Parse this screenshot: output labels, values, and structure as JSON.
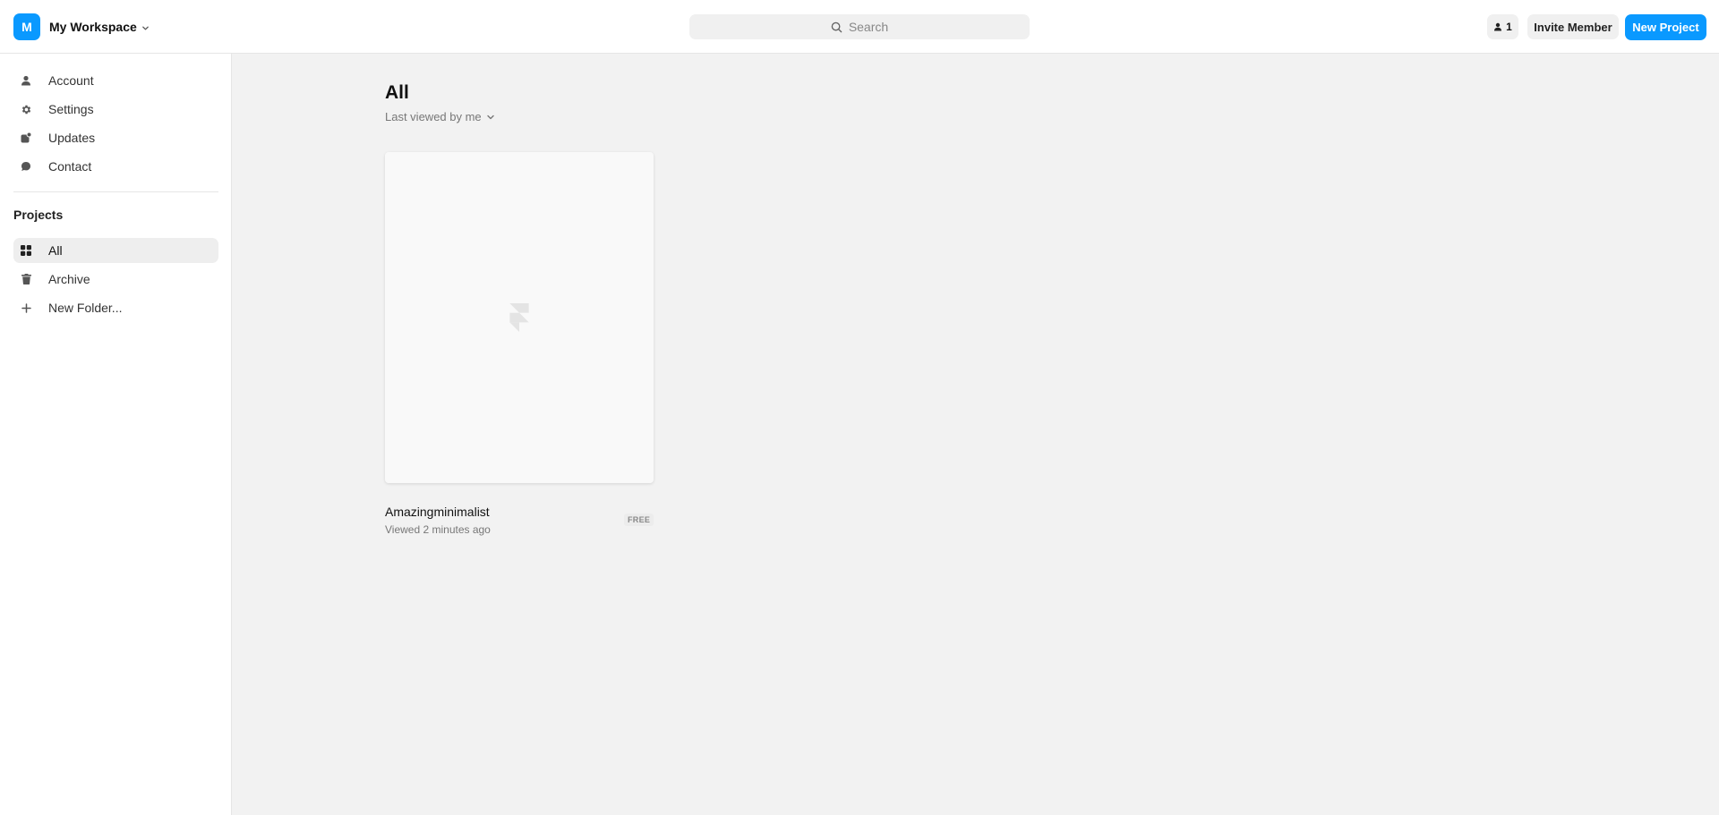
{
  "header": {
    "workspace_initial": "M",
    "workspace_name": "My Workspace",
    "search_placeholder": "Search",
    "member_count": "1",
    "invite_label": "Invite Member",
    "new_project_label": "New Project"
  },
  "sidebar": {
    "nav": [
      {
        "label": "Account",
        "icon": "user-icon"
      },
      {
        "label": "Settings",
        "icon": "gear-icon"
      },
      {
        "label": "Updates",
        "icon": "updates-icon"
      },
      {
        "label": "Contact",
        "icon": "chat-bubble-icon"
      }
    ],
    "projects_title": "Projects",
    "projects": [
      {
        "label": "All",
        "icon": "grid-icon",
        "active": true
      },
      {
        "label": "Archive",
        "icon": "trash-icon",
        "active": false
      },
      {
        "label": "New Folder...",
        "icon": "plus-icon",
        "active": false
      }
    ]
  },
  "main": {
    "title": "All",
    "sort_label": "Last viewed by me",
    "projects": [
      {
        "name": "Amazingminimalist",
        "viewed": "Viewed 2 minutes ago",
        "plan": "FREE"
      }
    ]
  },
  "colors": {
    "accent": "#0a99ff",
    "background": "#f2f2f2",
    "surface": "#ffffff"
  }
}
